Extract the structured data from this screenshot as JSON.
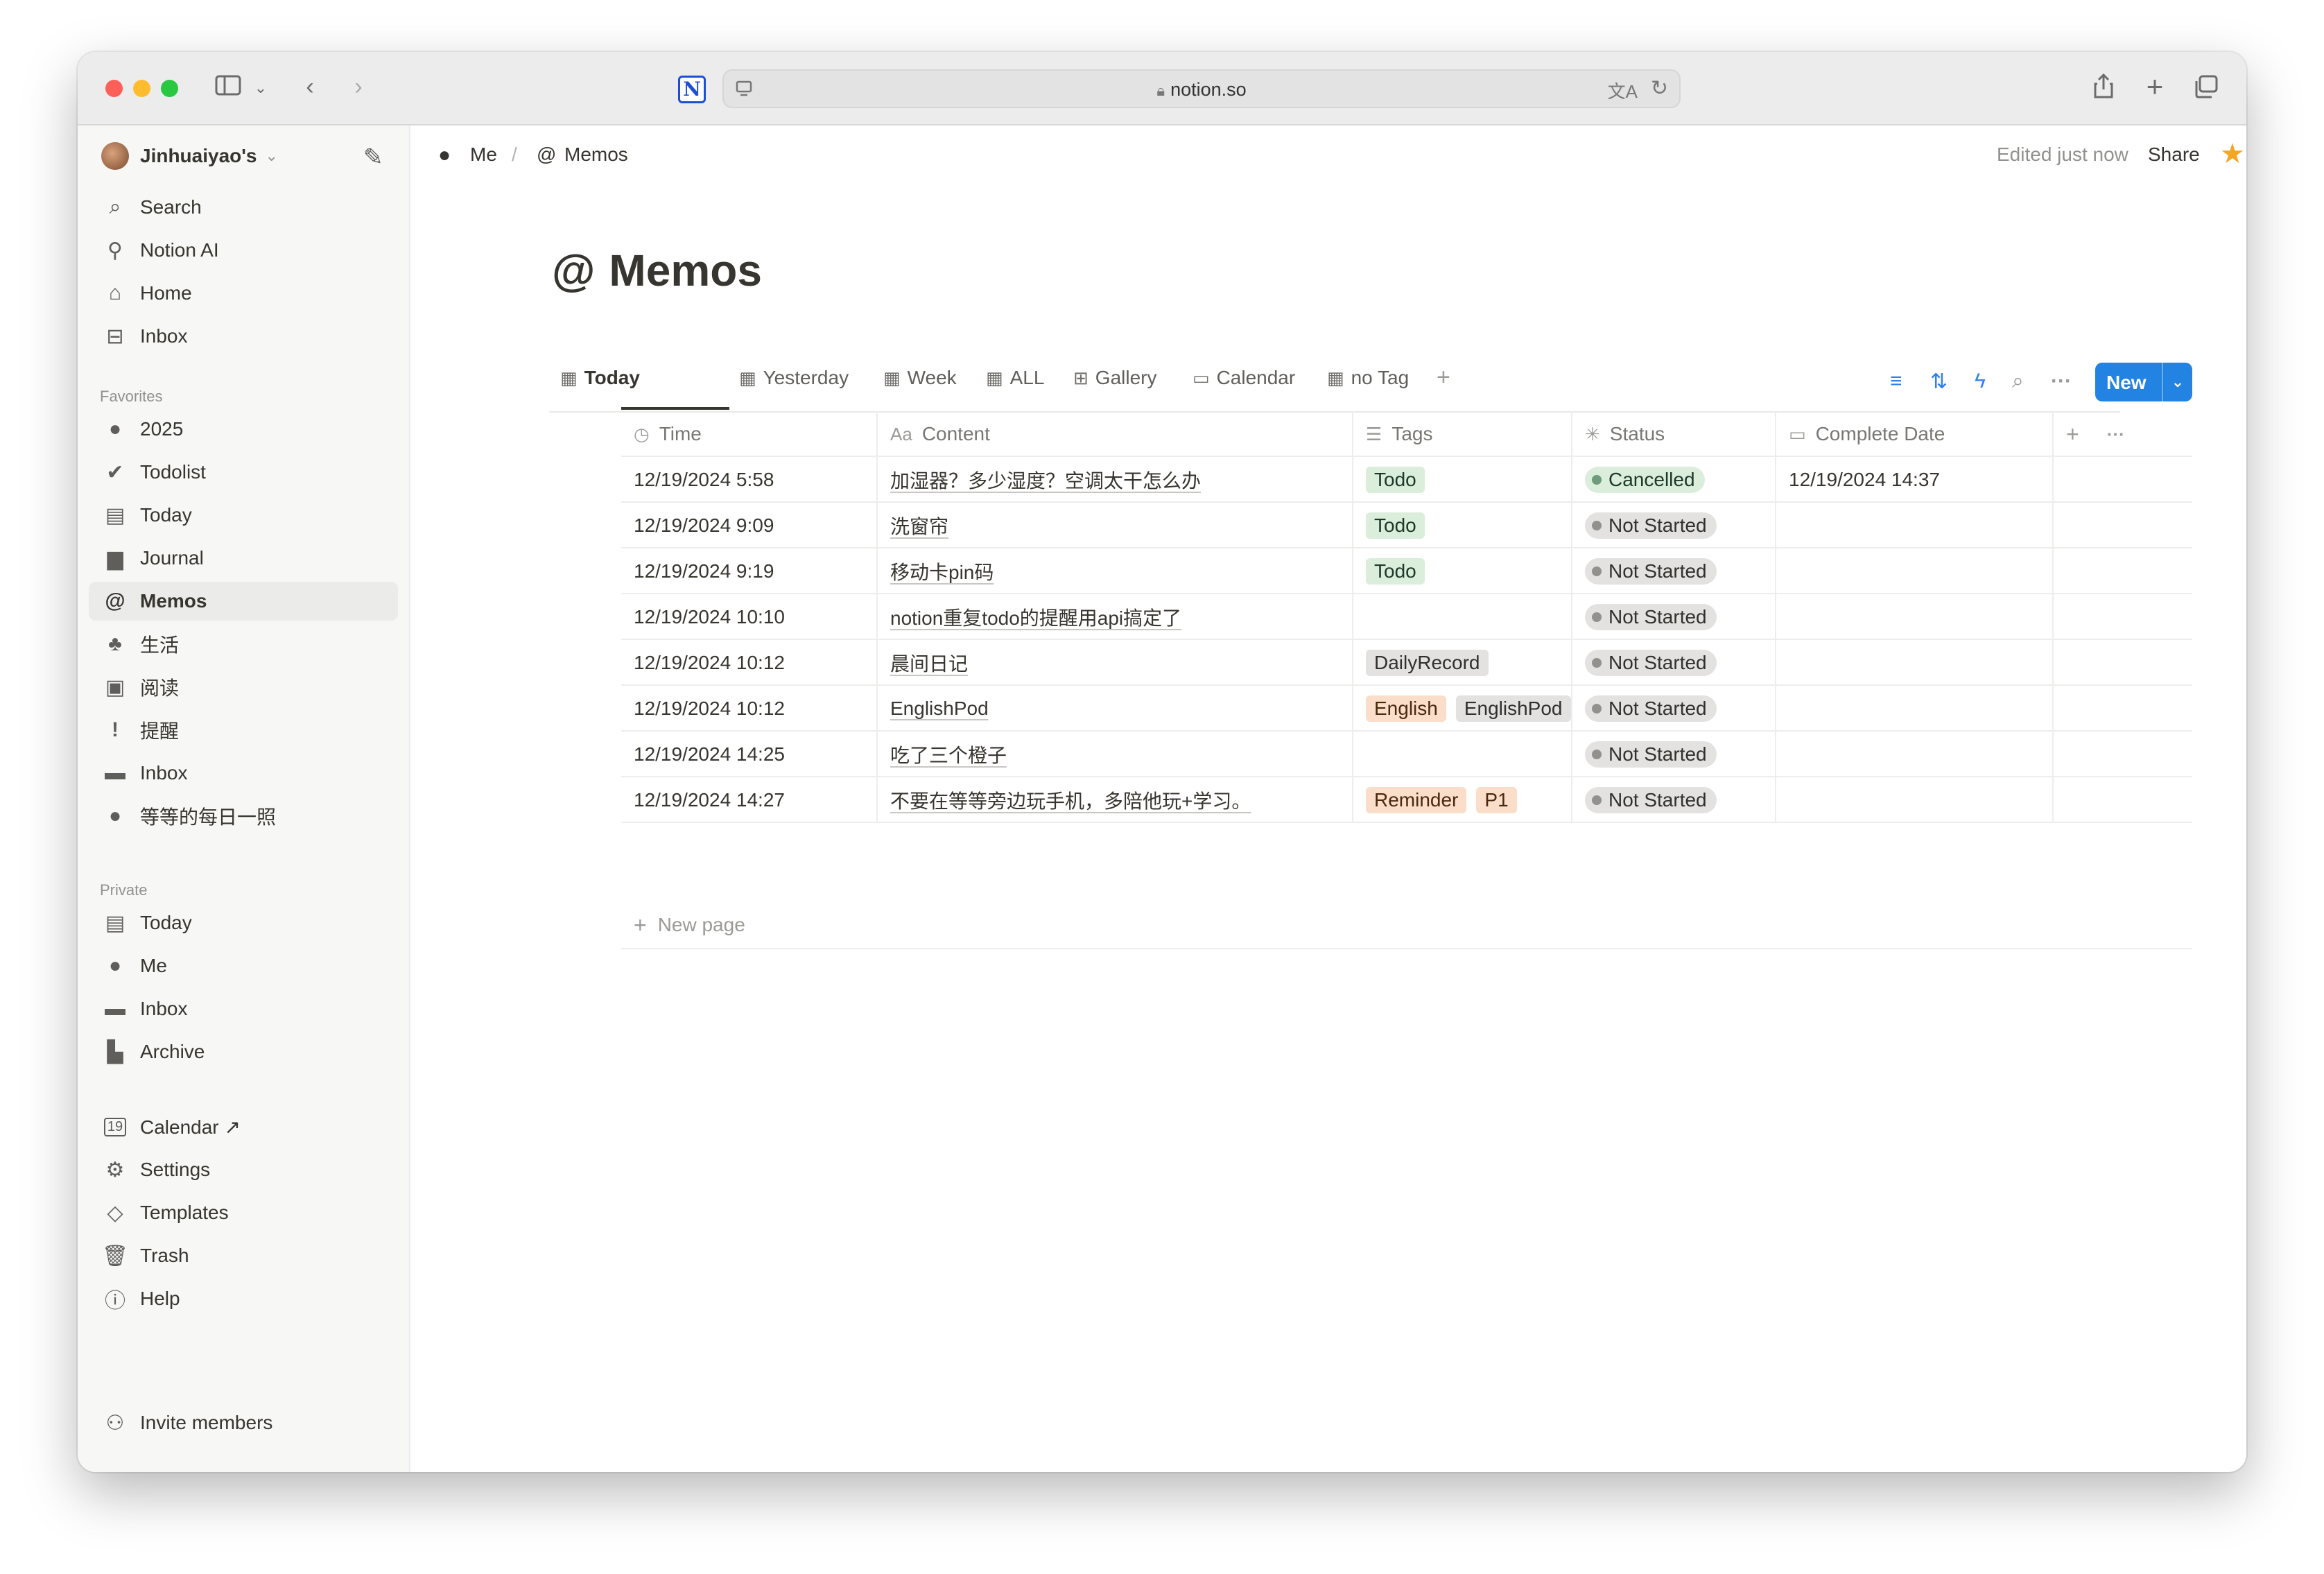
{
  "browser": {
    "url": "notion.so",
    "logo_letter": "N"
  },
  "sidebar": {
    "workspace": "Jinhuaiyao's",
    "top_items": [
      {
        "label": "Search",
        "icon": "search-icon"
      },
      {
        "label": "Notion AI",
        "icon": "notion-ai-icon"
      },
      {
        "label": "Home",
        "icon": "home-icon"
      },
      {
        "label": "Inbox",
        "icon": "inbox-icon"
      }
    ],
    "favorites_title": "Favorites",
    "favorites": [
      {
        "label": "2025",
        "icon": "apple-icon"
      },
      {
        "label": "Todolist",
        "icon": "check-circle-icon"
      },
      {
        "label": "Today",
        "icon": "calendar-icon"
      },
      {
        "label": "Journal",
        "icon": "document-icon"
      },
      {
        "label": "Memos",
        "icon": "at-icon"
      },
      {
        "label": "生活",
        "icon": "plant-icon"
      },
      {
        "label": "阅读",
        "icon": "book-icon"
      },
      {
        "label": "提醒",
        "icon": "exclamation-icon"
      },
      {
        "label": "Inbox",
        "icon": "archive-box-icon"
      },
      {
        "label": "等等的每日一照",
        "icon": "apple-icon"
      }
    ],
    "private_title": "Private",
    "private": [
      {
        "label": "Today",
        "icon": "calendar-icon"
      },
      {
        "label": "Me",
        "icon": "apple-icon"
      },
      {
        "label": "Inbox",
        "icon": "archive-box-icon"
      },
      {
        "label": "Archive",
        "icon": "archive-icon"
      }
    ],
    "bottom": [
      {
        "label": "Calendar ↗",
        "icon": "calendar-19-icon"
      },
      {
        "label": "Settings",
        "icon": "gear-icon"
      },
      {
        "label": "Templates",
        "icon": "templates-icon"
      },
      {
        "label": "Trash",
        "icon": "trash-icon"
      },
      {
        "label": "Help",
        "icon": "help-icon"
      }
    ],
    "invite": "Invite members"
  },
  "header": {
    "breadcrumb": [
      "Me",
      "/",
      "Memos"
    ],
    "edited": "Edited just now",
    "share": "Share"
  },
  "page": {
    "title": "Memos",
    "tabs": [
      "Today",
      "Yesterday",
      "Week",
      "ALL",
      "Gallery",
      "Calendar",
      "no Tag"
    ],
    "new_button": "New"
  },
  "table": {
    "columns": [
      "Time",
      "Content",
      "Tags",
      "Status",
      "Complete Date"
    ],
    "column_icons": [
      "clock-icon",
      "text-icon",
      "list-icon",
      "status-icon",
      "calendar-icon"
    ],
    "rows": [
      {
        "time": "12/19/2024 5:58",
        "content": "加湿器？多少湿度？空调太干怎么办",
        "tags": [
          {
            "label": "Todo",
            "color": "todo"
          }
        ],
        "status": "Cancelled",
        "status_kind": "cancelled",
        "complete": "12/19/2024 14:37"
      },
      {
        "time": "12/19/2024 9:09",
        "content": "洗窗帘",
        "tags": [
          {
            "label": "Todo",
            "color": "todo"
          }
        ],
        "status": "Not Started",
        "status_kind": "notstarted",
        "complete": ""
      },
      {
        "time": "12/19/2024 9:19",
        "content": "移动卡pin码",
        "tags": [
          {
            "label": "Todo",
            "color": "todo"
          }
        ],
        "status": "Not Started",
        "status_kind": "notstarted",
        "complete": ""
      },
      {
        "time": "12/19/2024 10:10",
        "content": "notion重复todo的提醒用api搞定了",
        "tags": [],
        "status": "Not Started",
        "status_kind": "notstarted",
        "complete": ""
      },
      {
        "time": "12/19/2024 10:12",
        "content": "晨间日记",
        "tags": [
          {
            "label": "DailyRecord",
            "color": "grey"
          }
        ],
        "status": "Not Started",
        "status_kind": "notstarted",
        "complete": ""
      },
      {
        "time": "12/19/2024 10:12",
        "content": "EnglishPod",
        "tags": [
          {
            "label": "English",
            "color": "orange"
          },
          {
            "label": "EnglishPod",
            "color": "grey"
          }
        ],
        "status": "Not Started",
        "status_kind": "notstarted",
        "complete": ""
      },
      {
        "time": "12/19/2024 14:25",
        "content": "吃了三个橙子",
        "tags": [],
        "status": "Not Started",
        "status_kind": "notstarted",
        "complete": ""
      },
      {
        "time": "12/19/2024 14:27",
        "content": "不要在等等旁边玩手机，多陪他玩+学习。",
        "tags": [
          {
            "label": "Reminder",
            "color": "orange"
          },
          {
            "label": "P1",
            "color": "orange"
          }
        ],
        "status": "Not Started",
        "status_kind": "notstarted",
        "complete": ""
      }
    ],
    "new_page": "New page"
  }
}
